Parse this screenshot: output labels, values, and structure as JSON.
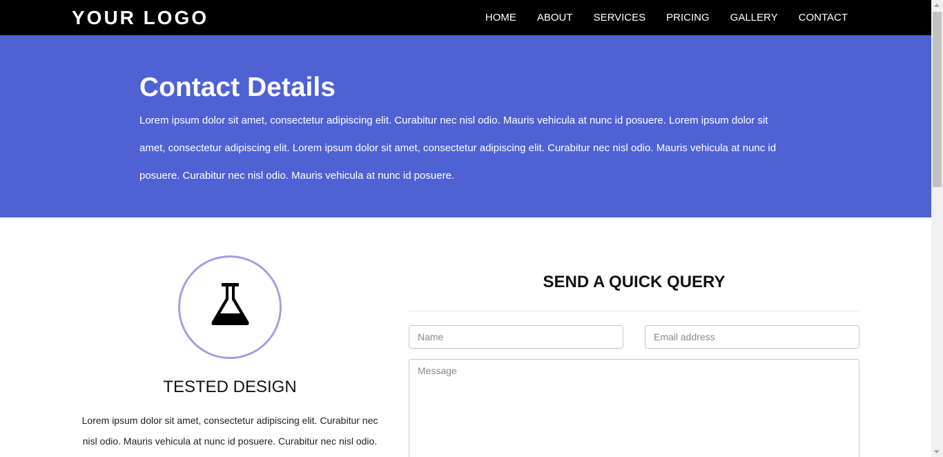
{
  "header": {
    "logo": "YOUR LOGO",
    "nav": [
      {
        "label": "HOME"
      },
      {
        "label": "ABOUT"
      },
      {
        "label": "SERVICES"
      },
      {
        "label": "PRICING"
      },
      {
        "label": "GALLERY"
      },
      {
        "label": "CONTACT"
      }
    ]
  },
  "hero": {
    "title": "Contact Details",
    "text": "Lorem ipsum dolor sit amet, consectetur adipiscing elit. Curabitur nec nisl odio. Mauris vehicula at nunc id posuere. Lorem ipsum dolor sit amet, consectetur adipiscing elit. Lorem ipsum dolor sit amet, consectetur adipiscing elit. Curabitur nec nisl odio. Mauris vehicula at nunc id posuere. Curabitur nec nisl odio. Mauris vehicula at nunc id posuere.",
    "background_color": "#4f62d4"
  },
  "feature": {
    "icon": "flask-icon",
    "title": "TESTED DESIGN",
    "text": "Lorem ipsum dolor sit amet, consectetur adipiscing elit. Curabitur nec nisl odio. Mauris vehicula at nunc id posuere. Curabitur nec nisl odio. Mauris vehicula at nunc id posuere.",
    "circle_color": "#a49ee0"
  },
  "form": {
    "title": "SEND A QUICK QUERY",
    "name_placeholder": "Name",
    "email_placeholder": "Email address",
    "message_placeholder": "Message"
  }
}
